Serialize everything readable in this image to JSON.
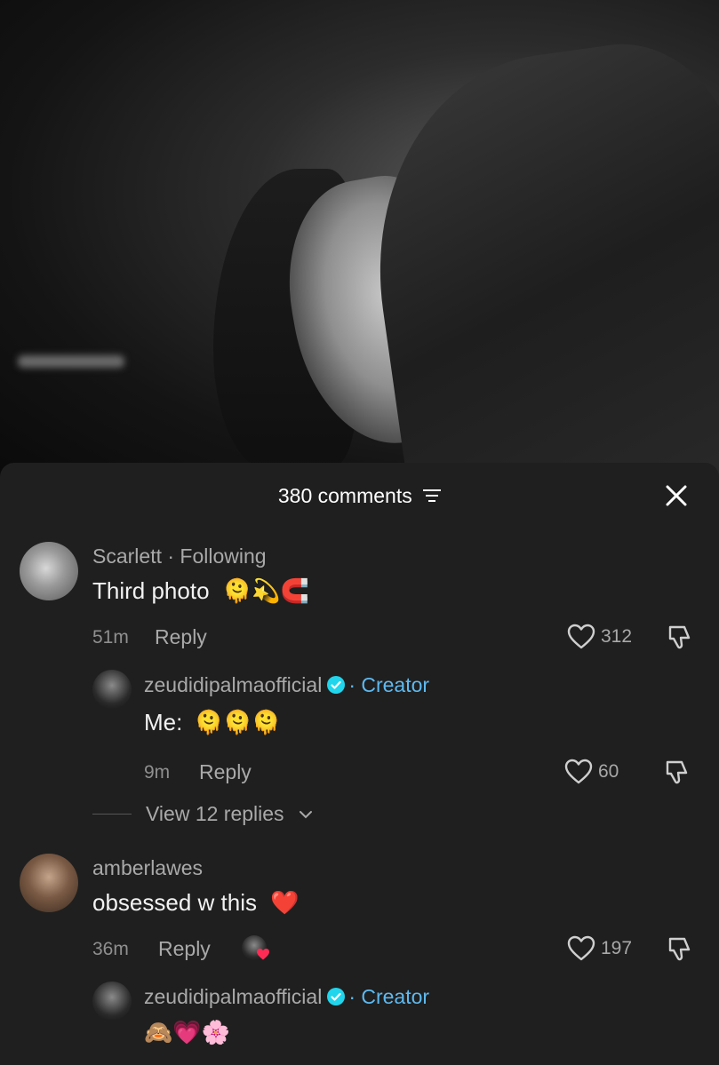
{
  "header": {
    "comment_count": "380 comments"
  },
  "comments": [
    {
      "author": "Scarlett",
      "relation": "· Following",
      "text": "Third photo",
      "emojis": "🫠💫🧲",
      "time": "51m",
      "reply_label": "Reply",
      "likes": "312"
    },
    {
      "author": "amberlawes",
      "text": "obsessed w this",
      "emojis": "❤️",
      "time": "36m",
      "reply_label": "Reply",
      "likes": "197"
    }
  ],
  "replies": [
    {
      "author": "zeudidipalmaofficial",
      "badge": "· Creator",
      "text": "Me:",
      "emojis": "🫠🫠🫠",
      "time": "9m",
      "reply_label": "Reply",
      "likes": "60"
    },
    {
      "author": "zeudidipalmaofficial",
      "badge": "· Creator",
      "emojis": "🙈💗🌸"
    }
  ],
  "view_replies": "View 12 replies",
  "colors": {
    "sheet_bg": "#1f1f1f",
    "creator_blue": "#5eb9ef",
    "muted_text": "#a9a9a9"
  }
}
